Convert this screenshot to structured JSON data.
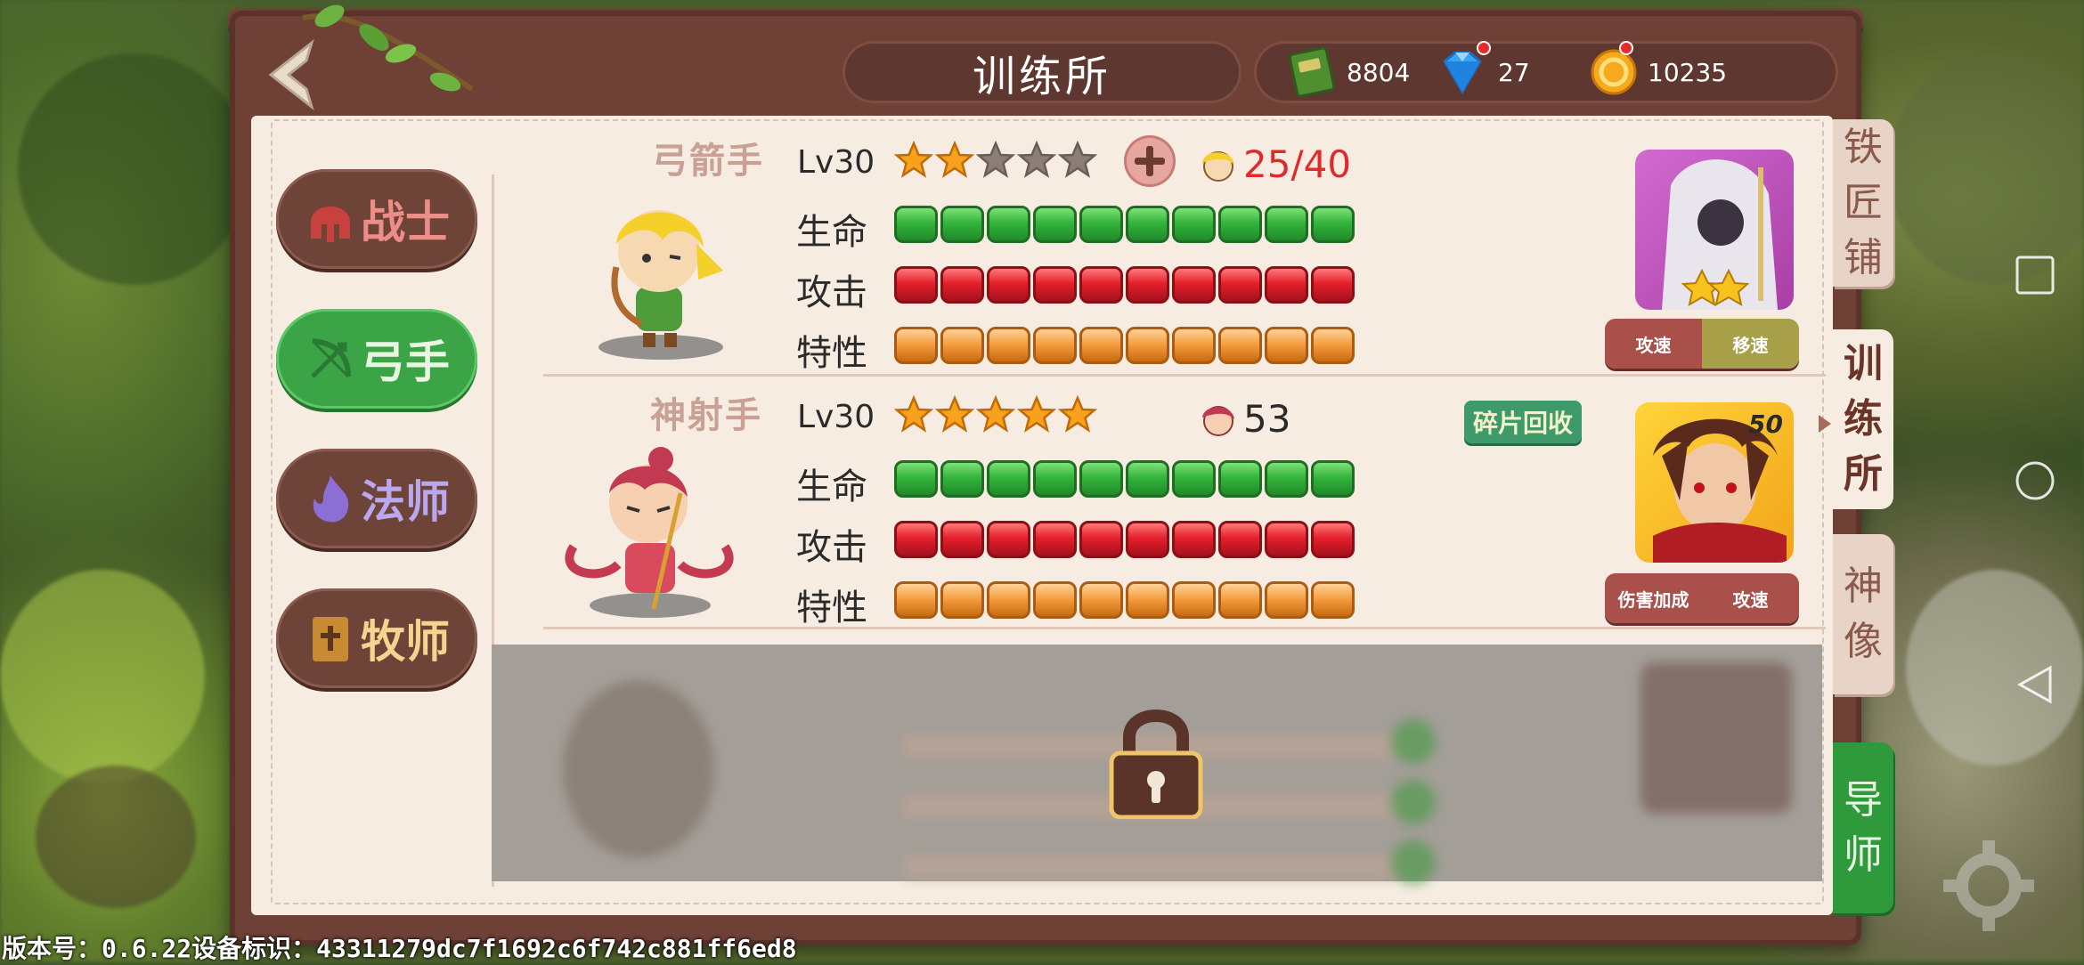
{
  "header": {
    "title": "训练所",
    "resources": [
      {
        "icon": "book-icon",
        "value": "8804"
      },
      {
        "icon": "diamond-icon",
        "value": "27"
      },
      {
        "icon": "gold-coin-icon",
        "value": "10235"
      }
    ]
  },
  "classes": [
    {
      "label": "战士",
      "icon": "helmet-icon",
      "active": false
    },
    {
      "label": "弓手",
      "icon": "bow-icon",
      "active": true
    },
    {
      "label": "法师",
      "icon": "flame-icon",
      "active": false
    },
    {
      "label": "牧师",
      "icon": "holy-book-icon",
      "active": false
    }
  ],
  "heroes": [
    {
      "name": "弓箭手",
      "level": "Lv30",
      "stars_filled": 2,
      "stars_total": 5,
      "fragments": "25/40",
      "stats": [
        {
          "label": "生命",
          "pips": 10,
          "color": "green"
        },
        {
          "label": "攻击",
          "pips": 10,
          "color": "red"
        },
        {
          "label": "特性",
          "pips": 10,
          "color": "orange"
        }
      ],
      "tutor_stars": 2,
      "skills": [
        "攻速",
        "移速"
      ]
    },
    {
      "name": "神射手",
      "level": "Lv30",
      "stars_filled": 5,
      "stars_total": 5,
      "fragments": "53",
      "recycle_label": "碎片回收",
      "stats": [
        {
          "label": "生命",
          "pips": 10,
          "color": "green"
        },
        {
          "label": "攻击",
          "pips": 10,
          "color": "red"
        },
        {
          "label": "特性",
          "pips": 10,
          "color": "orange"
        }
      ],
      "portrait_badge": "50",
      "skills": [
        "伤害加成",
        "攻速"
      ]
    }
  ],
  "side_tabs": [
    {
      "label": [
        "铁",
        "匠",
        "铺"
      ],
      "active": false
    },
    {
      "label": [
        "训",
        "练",
        "所"
      ],
      "active": true
    },
    {
      "label": [
        "神",
        "像"
      ],
      "active": false
    },
    {
      "label": [
        "导",
        "师"
      ],
      "active": false,
      "accent": true
    }
  ],
  "footer": {
    "version": "版本号：0.6.22设备标识：43311279dc7f1692c6f742c881ff6ed8"
  },
  "colors": {
    "board": "#6e4036",
    "paper": "#f6ece2",
    "active_class": "#3ba446",
    "tab_accent": "#2e9a3c",
    "fragment_text": "#e02a2a"
  }
}
